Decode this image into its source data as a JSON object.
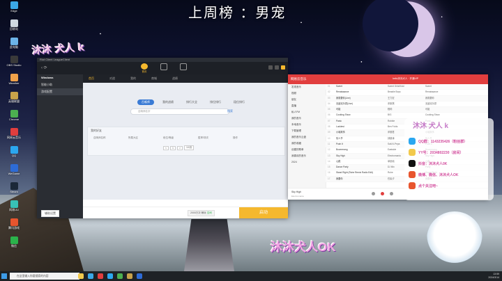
{
  "banner": {
    "title": "上周榜 ：男宠"
  },
  "brand": {
    "text": "沐沐犬人0K",
    "small_text": "沐沐 犬人 k"
  },
  "desktop": {
    "icons": [
      {
        "label": "Edge",
        "color": "#3ba7e6"
      },
      {
        "label": "回收站",
        "color": "#cfd8e0"
      },
      {
        "label": "此电脑",
        "color": "#6cb4e8"
      },
      {
        "label": "OBS Studio",
        "color": "#3a3a3a"
      },
      {
        "label": "Weather",
        "color": "#f0a14a"
      },
      {
        "label": "英雄联盟",
        "color": "#c8a24a"
      },
      {
        "label": "Chrome",
        "color": "#4caf50"
      },
      {
        "label": "网易云音乐",
        "color": "#e13e3e"
      },
      {
        "label": "QQ",
        "color": "#2ba7f0"
      },
      {
        "label": "WeGame",
        "color": "#2d6bd6"
      },
      {
        "label": "Steam",
        "color": "#1b2838"
      },
      {
        "label": "网易UU",
        "color": "#38c0b6"
      },
      {
        "label": "腾讯游戏",
        "color": "#e8552e"
      },
      {
        "label": "微信",
        "color": "#2bb34b"
      }
    ]
  },
  "left_app": {
    "window_title": "Riot Client LeagueClient",
    "header": {
      "tabs": [
        {
          "label": "首页",
          "active": true
        },
        {
          "label": "",
          "active": false
        },
        {
          "label": "",
          "active": false
        }
      ]
    },
    "sidebar": {
      "title": "Windows",
      "items": [
        {
          "label": "智能小助"
        },
        {
          "label": "游戏配置"
        }
      ]
    },
    "subnav": [
      "首页",
      "对战",
      "我的",
      "商城",
      "战绩"
    ],
    "tabs": [
      "召唤师",
      "我的战绩",
      "排行大全",
      "排位排行",
      "段位排行"
    ],
    "search_placeholder": "召唤师名字",
    "search_button": "搜索",
    "table": {
      "title": "我的好友",
      "columns": [
        "召唤师名称",
        "所属大区",
        "段位/等级",
        "胜率/场次",
        "操作"
      ]
    },
    "pager": [
      "<",
      "1",
      ">",
      "10/页"
    ],
    "footer": {
      "tool": "辅助设置",
      "mode_label": "2000万次 畅玩",
      "mode_status": "空闲",
      "launch": "启动"
    }
  },
  "right_app": {
    "logo": "网易云音乐",
    "user": "hello沐沐犬人  ·  开通VIP",
    "sidebar": [
      "发现音乐",
      "视频",
      "朋友",
      "直播",
      "私人FM",
      "我的音乐",
      "本地音乐",
      "下载管理",
      "我的音乐云盘",
      "我的收藏",
      "创建的歌单",
      "我喜欢的音乐",
      "2024"
    ],
    "tracks": [
      {
        "title": "Sweet",
        "artist": "Sweet Girls/Kidd",
        "album": "Sweet"
      },
      {
        "title": "Renaissance",
        "artist": "Beastie Boys",
        "album": "Renaissance"
      },
      {
        "title": "我需要你(Live)",
        "artist": "王力宏",
        "album": "我需要你"
      },
      {
        "title": "无敌欢乐颂(Live)",
        "artist": "邓紫棋",
        "album": "无敌欢乐颂"
      },
      {
        "title": "可能",
        "artist": "程响",
        "album": "可能"
      },
      {
        "title": "Cooking Show",
        "artist": "BIG",
        "album": "Cooking Show"
      },
      {
        "title": "Panic",
        "artist": "Robbie",
        "album": "Panic"
      },
      {
        "title": "Luckiest",
        "artist": "Ben Folds",
        "album": "Rockin'"
      },
      {
        "title": "小城故事",
        "artist": "邓丽君",
        "album": "小城故事"
      },
      {
        "title": "情人节",
        "artist": "钟镇涛",
        "album": "情人节"
      },
      {
        "title": "Push It",
        "artist": "Salt-N-Pepa",
        "album": "Push It"
      },
      {
        "title": "Boomerang",
        "artist": "Eastside",
        "album": "Boomerang"
      },
      {
        "title": "Sky High",
        "artist": "Electromania",
        "album": "Sky High"
      },
      {
        "title": "心跳",
        "artist": "单依纯",
        "album": "心跳"
      },
      {
        "title": "Dance Party",
        "artist": "DJ Mix",
        "album": "Party"
      },
      {
        "title": "Stand Right (Ruhe Remix Radio Edit)",
        "artist": "Ruhe",
        "album": "Stand Right"
      },
      {
        "title": "我要你",
        "artist": "任素汐",
        "album": "我要你"
      }
    ],
    "player": {
      "song": "Sky High",
      "sub": "Electromania"
    }
  },
  "overlay": {
    "header": "沐沐 犬人 k",
    "lines": [
      {
        "text": "QQ群：1143235426（粉丝群）",
        "color": "#2ba7f0"
      },
      {
        "text": "YY号：2034802230（房间）",
        "color": "#f2c94c"
      },
      {
        "text": "抖音：沐沐犬人0K",
        "color": "#111111"
      },
      {
        "text": "微博、微信、沐沐犬人OK",
        "color": "#e8552e"
      },
      {
        "text": "点个关注吧~",
        "color": "#e8552e"
      }
    ],
    "big_brand": "沐沐犬人OK"
  },
  "taskbar": {
    "search_placeholder": "在这里输入你要搜索的内容",
    "tray_time": "13:59",
    "tray_date": "2024/3/14",
    "apps": [
      "#f2c94c",
      "#3ba7e6",
      "#e13e3e",
      "#2ba7f0",
      "#4caf50",
      "#c8a24a",
      "#2d6bd6"
    ]
  }
}
